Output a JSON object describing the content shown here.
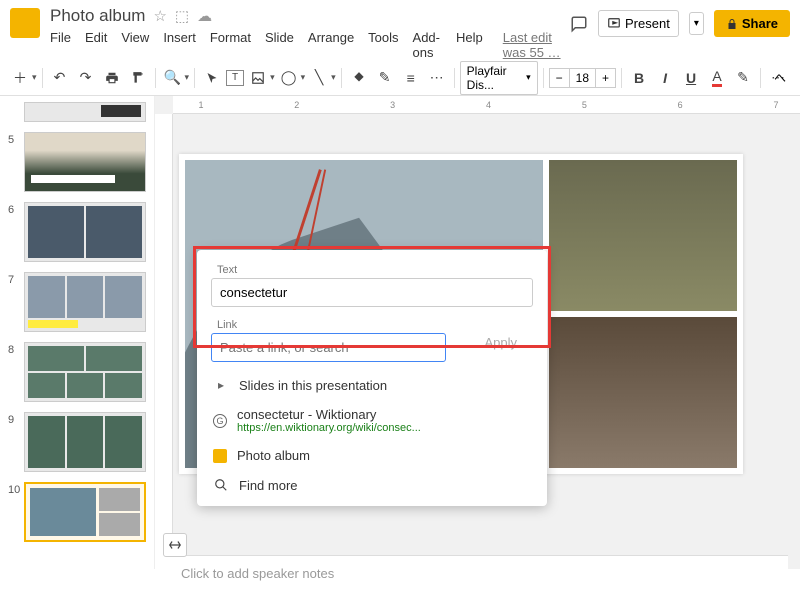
{
  "header": {
    "title": "Photo album",
    "star_icon": "☆",
    "move_icon": "⬚",
    "cloud_icon": "☁",
    "menus": [
      "File",
      "Edit",
      "View",
      "Insert",
      "Format",
      "Slide",
      "Arrange",
      "Tools",
      "Add-ons",
      "Help"
    ],
    "last_edit": "Last edit was 55 …",
    "comments_icon": "💬",
    "present": "Present",
    "share": "Share"
  },
  "toolbar": {
    "font_name": "Playfair Dis...",
    "font_size": "18"
  },
  "thumbs": [
    {
      "num": "5"
    },
    {
      "num": "6"
    },
    {
      "num": "7"
    },
    {
      "num": "8"
    },
    {
      "num": "9"
    },
    {
      "num": "10"
    }
  ],
  "ruler": [
    "1",
    "",
    "2",
    "",
    "3",
    "",
    "4",
    "",
    "5",
    "",
    "6",
    "",
    "7"
  ],
  "link_popup": {
    "text_label": "Text",
    "text_value": "consectetur",
    "link_label": "Link",
    "link_placeholder": "Paste a link, or search",
    "apply": "Apply",
    "slides_item": "Slides in this presentation",
    "suggest_title": "consectetur - Wiktionary",
    "suggest_url": "https://en.wiktionary.org/wiki/consec...",
    "album_item": "Photo album",
    "findmore": "Find more"
  },
  "notes": {
    "placeholder": "Click to add speaker notes"
  }
}
